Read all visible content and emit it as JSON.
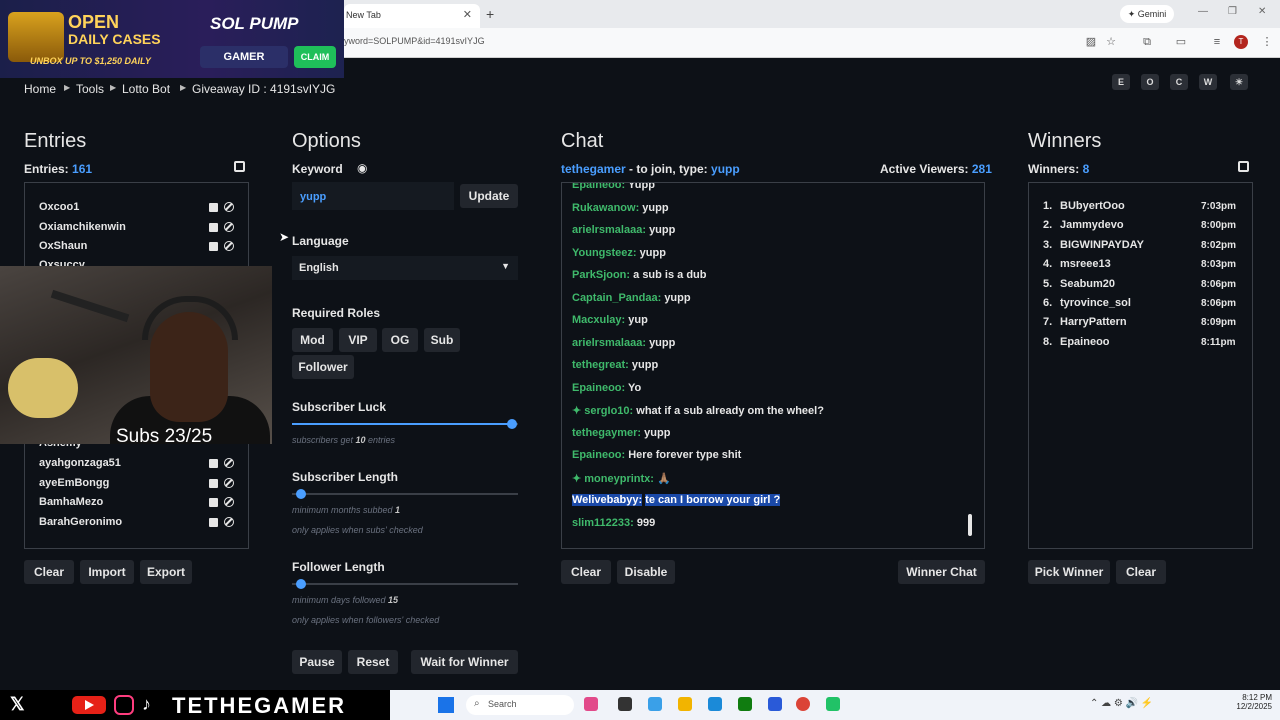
{
  "browser": {
    "tab_title": "New Tab",
    "tab_close": "✕",
    "new_tab": "+",
    "gemini": "✦ Gemini",
    "url": "yword=SOLPUMP&id=4191svIYJG",
    "avatar": "T",
    "controls": [
      "—",
      "❐",
      "✕"
    ]
  },
  "ad": {
    "line1": "OPEN",
    "line2": "DAILY CASES",
    "tagline": "UNBOX UP TO $1,250 DAILY",
    "brand": "SOL PUMP",
    "gamer_button": "GAMER",
    "claim_button": "CLAIM"
  },
  "breadcrumb": [
    "Home",
    "Tools",
    "Lotto Bot",
    "Giveaway ID : 4191svIYJG"
  ],
  "top_keys": [
    "E",
    "O",
    "C",
    "W",
    "☀"
  ],
  "entries": {
    "title": "Entries",
    "count_label": "Entries:",
    "count": "161",
    "items_top": [
      "Oxcoo1",
      "Oxiamchikenwin",
      "OxShaun",
      "Oxsuccy"
    ],
    "items_bottom": [
      "Ashemy",
      "ayahgonzaga51",
      "ayeEmBongg",
      "BamhaMezo",
      "BarahGeronimo"
    ],
    "buttons": {
      "clear": "Clear",
      "import": "Import",
      "export": "Export"
    }
  },
  "options": {
    "title": "Options",
    "keyword_label": "Keyword",
    "keyword_value": "yupp",
    "update_button": "Update",
    "language_label": "Language",
    "language_value": "English",
    "roles_label": "Required Roles",
    "roles": [
      "Mod",
      "VIP",
      "OG",
      "Sub",
      "Follower"
    ],
    "sub_luck": {
      "label": "Subscriber Luck",
      "hint_pre": "subscribers get ",
      "value": "10",
      "hint_post": " entries",
      "level": 1.0
    },
    "sub_length": {
      "label": "Subscriber Length",
      "hint_pre": "minimum months subbed ",
      "value": "1",
      "hint2": "only applies when subs' checked",
      "level": 0.0
    },
    "follower_length": {
      "label": "Follower Length",
      "hint_pre": "minimum days followed ",
      "value": "15",
      "hint2": "only applies when followers' checked",
      "level": 0.0
    },
    "buttons": {
      "pause": "Pause",
      "reset": "Reset",
      "wait": "Wait for Winner"
    }
  },
  "chat": {
    "title": "Chat",
    "channel": "tethegamer",
    "join_text": " - to join, type: ",
    "join_keyword": "yupp",
    "viewers_label": "Active Viewers:",
    "viewers": "281",
    "messages": [
      {
        "user": "Epaineoo:",
        "text": "Yupp",
        "star": false,
        "hl": false
      },
      {
        "user": "Rukawanow:",
        "text": "yupp",
        "star": false,
        "hl": false
      },
      {
        "user": "arielrsmalaaa:",
        "text": "yupp",
        "star": false,
        "hl": false
      },
      {
        "user": "Youngsteez:",
        "text": "yupp",
        "star": false,
        "hl": false
      },
      {
        "user": "ParkSjoon:",
        "text": "a sub is a dub",
        "star": false,
        "hl": false
      },
      {
        "user": "Captain_Pandaa:",
        "text": "yupp",
        "star": false,
        "hl": false
      },
      {
        "user": "Macxulay:",
        "text": "yup",
        "star": false,
        "hl": false
      },
      {
        "user": "arielrsmalaaa:",
        "text": "yupp",
        "star": false,
        "hl": false
      },
      {
        "user": "tethegreat:",
        "text": "yupp",
        "star": false,
        "hl": false
      },
      {
        "user": "Epaineoo:",
        "text": "Yo",
        "star": false,
        "hl": false
      },
      {
        "user": "sergIo10:",
        "text": "what if a sub already om the wheel?",
        "star": true,
        "hl": false
      },
      {
        "user": "tethegaymer:",
        "text": "yupp",
        "star": false,
        "hl": false
      },
      {
        "user": "Epaineoo:",
        "text": "Here forever type shit",
        "star": false,
        "hl": false
      },
      {
        "user": "moneyprintx:",
        "text": "🙏🏽",
        "star": true,
        "hl": false
      },
      {
        "user": "Welivebabyy:",
        "text": "te can I borrow your girl ?",
        "star": false,
        "hl": true
      },
      {
        "user": "slim112233:",
        "text": "999",
        "star": false,
        "hl": false
      }
    ],
    "buttons": {
      "clear": "Clear",
      "disable": "Disable",
      "winner_chat": "Winner Chat"
    }
  },
  "winners": {
    "title": "Winners",
    "count_label": "Winners:",
    "count": "8",
    "list": [
      {
        "n": "1.",
        "name": "BUbyertOoo",
        "time": "7:03pm"
      },
      {
        "n": "2.",
        "name": "Jammydevo",
        "time": "8:00pm"
      },
      {
        "n": "3.",
        "name": "BIGWINPAYDAY",
        "time": "8:02pm"
      },
      {
        "n": "4.",
        "name": "msreee13",
        "time": "8:03pm"
      },
      {
        "n": "5.",
        "name": "Seabum20",
        "time": "8:06pm"
      },
      {
        "n": "6.",
        "name": "tyrovince_sol",
        "time": "8:06pm"
      },
      {
        "n": "7.",
        "name": "HarryPattern",
        "time": "8:09pm"
      },
      {
        "n": "8.",
        "name": "Epaineoo",
        "time": "8:11pm"
      }
    ],
    "buttons": {
      "pick": "Pick Winner",
      "clear": "Clear"
    }
  },
  "overlay": {
    "subs_text": "Subs 23/25",
    "social_name": "TETHEGAMER"
  },
  "taskbar": {
    "search": "Search",
    "time": "8:12 PM",
    "date": "12/2/2025"
  }
}
